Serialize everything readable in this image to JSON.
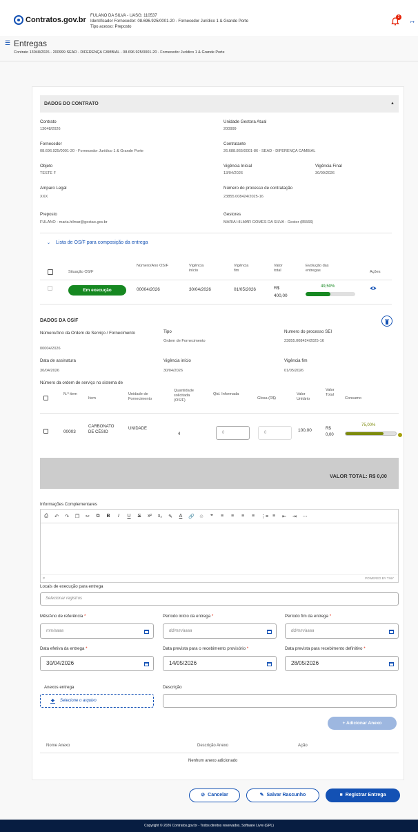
{
  "header": {
    "logo_text": "Contratos.gov.br",
    "user_line1": "FULANO DA SILVA - UASG: 110537",
    "user_line2": "Identificador Fornecedor: 08.696.925/0001-20 - Fornecedor Jurídico 1 & Grande Porte",
    "user_line3": "Tipo acesso: Preposto",
    "notification_count": "2"
  },
  "page": {
    "title": "Entregas",
    "subtitle": "Contrato 13048/2026 - 200999 SEAD - DIFERENÇA CAMBIAL - 08.696.925/0001-20 - Fornecedor Jurídico 1 & Grande Porte"
  },
  "contract": {
    "section_title": "DADOS DO CONTRATO",
    "fields": [
      {
        "label": "Contrato",
        "value": "13048/2026"
      },
      {
        "label": "Unidade Gestora Atual",
        "value": "200999"
      },
      {
        "label": "Fornecedor",
        "value": "08.696.925/0001-20 - Fornecedor Jurídico 1 & Grande Porte"
      },
      {
        "label": "Contratante",
        "value": "26.688.865/0001-86 - SEAD - DIFERENÇA CAMBIAL"
      },
      {
        "label": "Objeto",
        "value": "TESTE F"
      },
      {
        "label": "Vigência Inicial",
        "value": "13/04/2026"
      },
      {
        "label": "Vigência Final",
        "value": "30/09/2026"
      },
      {
        "label": "Amparo Legal",
        "value": "XXX"
      },
      {
        "label": "Número do processo de contratação",
        "value": "23855.008424/2025-16"
      },
      {
        "label": "Preposto",
        "value": "FULANO - maria.hilmar@gestao.gov.br"
      },
      {
        "label": "Gestores",
        "value": "MARIA HILMAR GOMES DA SILVA - Gestor (85566)"
      }
    ]
  },
  "os_list": {
    "toggle_label": "Lista de OS/F para composição da entrega",
    "columns": [
      "Situação OS/F",
      "Número/Ano OS/F",
      "Vigência início",
      "Vigência fim",
      "Valor total",
      "Evolução das entregas",
      "Ações"
    ],
    "row": {
      "status": "Em execução",
      "numero": "00004/2026",
      "inicio": "30/04/2026",
      "fim": "01/05/2026",
      "valor": "R$ 400,00",
      "evolucao_label": "49,50%",
      "evolucao": 49.5
    }
  },
  "osf": {
    "section_title": "DADOS DA OS/F",
    "fields": [
      {
        "label": "Número/Ano da Ordem de Serviço / Fornecimento",
        "value": "00004/2026"
      },
      {
        "label": "Tipo",
        "value": "Ordem de Fornecimento"
      },
      {
        "label": "Numero do processo SEI",
        "value": "23855.008424/2025-16"
      },
      {
        "label": "Data de assinatura",
        "value": "30/04/2026"
      },
      {
        "label": "Vigência início",
        "value": "30/04/2026"
      },
      {
        "label": "Vigência fim",
        "value": "01/05/2026"
      }
    ],
    "order_label": "Número da ordem de serviço no sistema de",
    "columns": [
      "N.º item",
      "Item",
      "Unidade de Fornecimento",
      "Quantidade solicitada (OS/F)",
      "Qtd. Informada",
      "Glosa (R$)",
      "Valor Unitário",
      "Valor Total",
      "Consumo"
    ],
    "item": {
      "numero": "00003",
      "item": "CARBONATO DE CÉSIO",
      "unidade": "UNIDADE",
      "quantidade": "4",
      "qtd_informada": "0",
      "glosa": "0",
      "valor_unitario": "100,00",
      "valor_total": "R$ 0,00",
      "consumo_label": "75,00%",
      "consumo": 75
    },
    "total_label": "VALOR TOTAL: R$ 0,00"
  },
  "form": {
    "info_label": "Informações Complementares",
    "editor_path": "P",
    "editor_brand": "POWERED BY TINY",
    "locais_label": "Locais de execução para entrega",
    "locais_placeholder": "Selecionar registros",
    "mes_ano_label": "Mês/Ano de referência",
    "mes_ano_placeholder": "mm/aaaa",
    "periodo_inicio_label": "Período início da entrega",
    "periodo_inicio_placeholder": "dd/mm/aaaa",
    "periodo_fim_label": "Período fim da entrega",
    "periodo_fim_placeholder": "dd/mm/aaaa",
    "data_efetiva_label": "Data efetiva da entrega",
    "data_efetiva_value": "30/04/2026",
    "data_prov_label": "Data prevista para o recebimento provisório",
    "data_prov_value": "14/05/2026",
    "data_def_label": "Data prevista para recebimento definitivo",
    "data_def_value": "28/05/2026",
    "anexos_label": "Anexos entrega",
    "upload_label": "Selecione o arquivo",
    "descricao_label": "Descrição",
    "add_anexo_label": "+ Adicionar Anexo",
    "anexo_columns": [
      "Nome Anexo",
      "Descrição Anexo",
      "Ação"
    ],
    "empty_text": "Nenhum anexo adicionado"
  },
  "actions": {
    "cancel": "Cancelar",
    "draft": "Salvar Rascunho",
    "submit": "Registrar Entrega"
  },
  "footer": {
    "text": "Copyright © 2026 Contratos.gov.br - Todos direitos reservados. Software Livre (GPL)"
  },
  "colors": {
    "primary": "#1351b4",
    "success": "#168821",
    "consumo_bar": "#7d8b0c",
    "footer_bg": "#071d41"
  }
}
